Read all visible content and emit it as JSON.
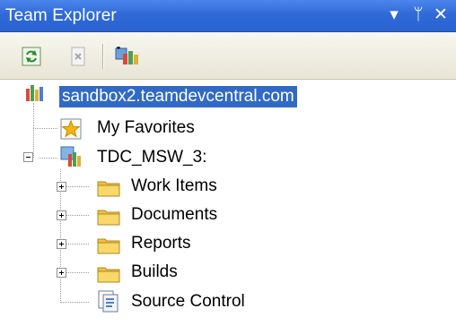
{
  "window": {
    "title": "Team Explorer"
  },
  "title_controls": {
    "dropdown": "▾",
    "pin": "ᛘ",
    "close": "✕"
  },
  "toolbar": {
    "buttons": [
      "refresh-icon",
      "delete-icon",
      "add-team-project-icon"
    ]
  },
  "tree": {
    "server": "sandbox2.teamdevcentral.com",
    "favorites": "My Favorites",
    "project": "TDC_MSW_3:",
    "children": [
      "Work Items",
      "Documents",
      "Reports",
      "Builds",
      "Source Control"
    ]
  }
}
